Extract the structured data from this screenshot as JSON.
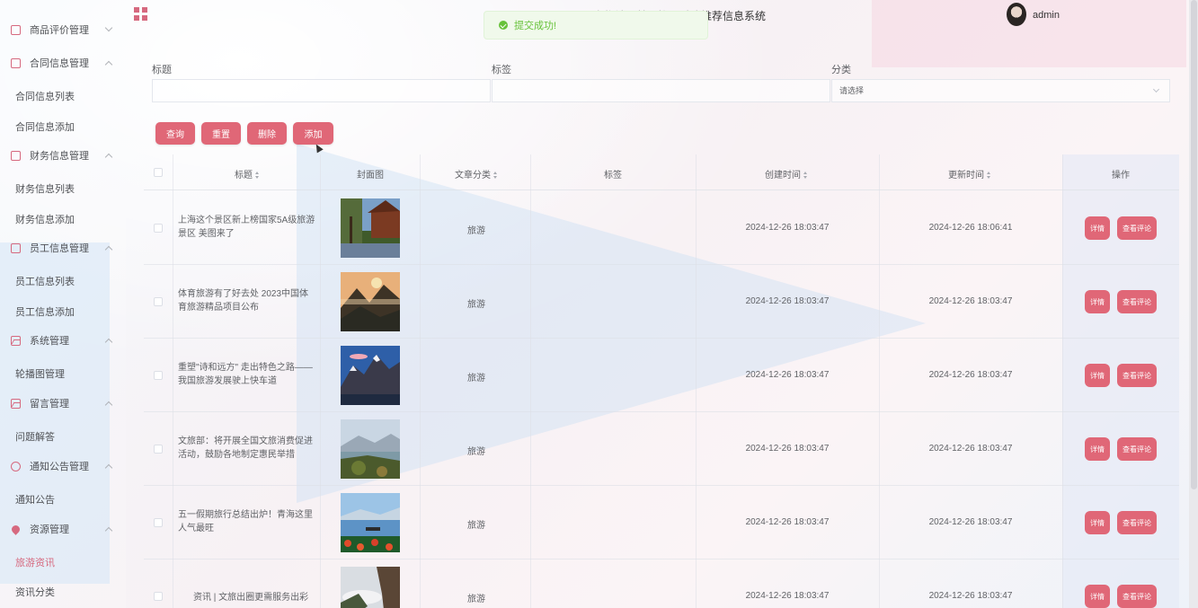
{
  "header": {
    "system_title": "宠物社区基于协同过滤推荐信息系统",
    "toast": "提交成功!",
    "user": "admin"
  },
  "sidebar": {
    "menus": [
      {
        "label": "商品评价管理",
        "icon": "doc-icon",
        "arrow": "down"
      },
      {
        "label": "合同信息管理",
        "icon": "doc-icon",
        "arrow": "up",
        "children": [
          "合同信息列表",
          "合同信息添加"
        ]
      },
      {
        "label": "财务信息管理",
        "icon": "doc-icon",
        "arrow": "up",
        "children": [
          "财务信息列表",
          "财务信息添加"
        ]
      },
      {
        "label": "员工信息管理",
        "icon": "doc-icon",
        "arrow": "up",
        "children": [
          "员工信息列表",
          "员工信息添加"
        ]
      },
      {
        "label": "系统管理",
        "icon": "picture-icon",
        "arrow": "up",
        "children": [
          "轮播图管理"
        ]
      },
      {
        "label": "留言管理",
        "icon": "picture-icon",
        "arrow": "up",
        "children": [
          "问题解答"
        ]
      },
      {
        "label": "通知公告管理",
        "icon": "info-circle-icon",
        "arrow": "up",
        "children": [
          "通知公告"
        ]
      },
      {
        "label": "资源管理",
        "icon": "location-pin-icon",
        "arrow": "up",
        "children": [
          "旅游资讯",
          "资讯分类"
        ]
      }
    ],
    "active_item": "旅游资讯"
  },
  "search": {
    "title_label": "标题",
    "tag_label": "标签",
    "category_label": "分类",
    "title_value": "",
    "tag_value": "",
    "category_placeholder": "请选择"
  },
  "buttons": {
    "query": "查询",
    "reset": "重置",
    "delete": "删除",
    "add": "添加"
  },
  "table": {
    "columns": [
      "标题",
      "封面图",
      "文章分类",
      "标签",
      "创建时间",
      "更新时间",
      "操作"
    ],
    "rows": [
      {
        "title": "上海这个景区新上榜国家5A级旅游景区 美图来了",
        "category": "旅游",
        "tag": "",
        "created": "2024-12-26 18:03:47",
        "updated": "2024-12-26 18:06:41"
      },
      {
        "title": "体育旅游有了好去处 2023中国体育旅游精品项目公布",
        "category": "旅游",
        "tag": "",
        "created": "2024-12-26 18:03:47",
        "updated": "2024-12-26 18:03:47"
      },
      {
        "title": "重塑\"诗和远方\" 走出特色之路——我国旅游发展驶上快车道",
        "category": "旅游",
        "tag": "",
        "created": "2024-12-26 18:03:47",
        "updated": "2024-12-26 18:03:47"
      },
      {
        "title": "文旅部：将开展全国文旅消费促进活动，鼓励各地制定惠民举措",
        "category": "旅游",
        "tag": "",
        "created": "2024-12-26 18:03:47",
        "updated": "2024-12-26 18:03:47"
      },
      {
        "title": "五一假期旅行总结出炉！青海这里人气最旺",
        "category": "旅游",
        "tag": "",
        "created": "2024-12-26 18:03:47",
        "updated": "2024-12-26 18:03:47"
      },
      {
        "title": "资讯 | 文旅出圈更需服务出彩",
        "category": "旅游",
        "tag": "",
        "created": "2024-12-26 18:03:47",
        "updated": "2024-12-26 18:03:47"
      }
    ],
    "detail_btn": "详情",
    "comment_btn": "查看评论"
  }
}
